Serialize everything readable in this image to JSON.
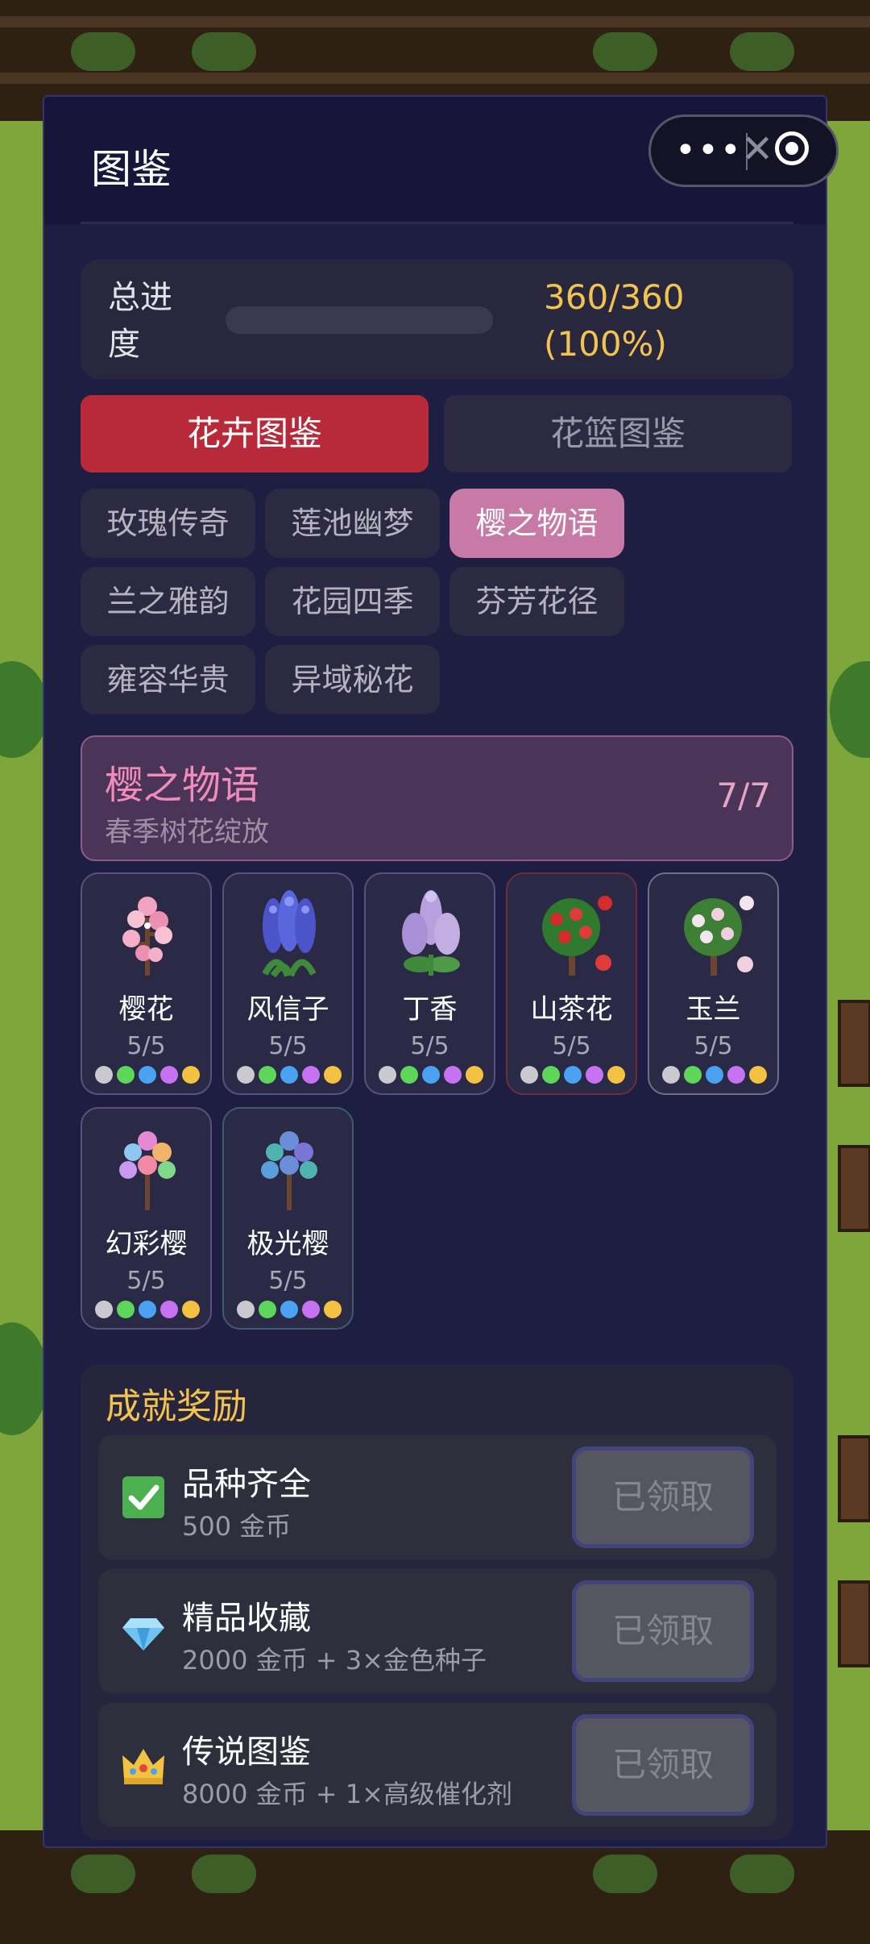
{
  "header": {
    "title": "图鉴",
    "capsule": {
      "more_icon": "more-dots-icon",
      "close_icon": "target-circle-icon",
      "more_label": "•••",
      "x_label": "✕"
    }
  },
  "progress": {
    "label": "总进度",
    "value_text": "360/360\n(100%)",
    "fraction": 1.0
  },
  "main_tabs": [
    {
      "label": "花卉图鉴",
      "active": true
    },
    {
      "label": "花篮图鉴",
      "active": false
    }
  ],
  "series_tabs": [
    {
      "label": "玫瑰传奇",
      "active": false
    },
    {
      "label": "莲池幽梦",
      "active": false
    },
    {
      "label": "樱之物语",
      "active": true
    },
    {
      "label": "兰之雅韵",
      "active": false
    },
    {
      "label": "花园四季",
      "active": false
    },
    {
      "label": "芬芳花径",
      "active": false
    },
    {
      "label": "雍容华贵",
      "active": false
    },
    {
      "label": "异域秘花",
      "active": false
    }
  ],
  "selected_series": {
    "name": "樱之物语",
    "description": "春季树花绽放",
    "count": "7/7"
  },
  "flowers": [
    {
      "name": "樱花",
      "count": "5/5",
      "art": "cherry-blossom-icon"
    },
    {
      "name": "风信子",
      "count": "5/5",
      "art": "hyacinth-icon"
    },
    {
      "name": "丁香",
      "count": "5/5",
      "art": "lilac-icon"
    },
    {
      "name": "山茶花",
      "count": "5/5",
      "art": "camellia-icon"
    },
    {
      "name": "玉兰",
      "count": "5/5",
      "art": "magnolia-icon"
    },
    {
      "name": "幻彩樱",
      "count": "5/5",
      "art": "rainbow-cherry-icon"
    },
    {
      "name": "极光樱",
      "count": "5/5",
      "art": "aurora-cherry-icon"
    }
  ],
  "quality_colors": [
    "#c9c9cf",
    "#5ed65a",
    "#4aa2f2",
    "#c772f2",
    "#f3c240"
  ],
  "achievements": {
    "title": "成就奖励",
    "items": [
      {
        "name": "品种齐全",
        "reward": "500 金币",
        "button": "已领取",
        "icon": "check-box-icon"
      },
      {
        "name": "精品收藏",
        "reward": "2000 金币 + 3×金色种子",
        "button": "已领取",
        "icon": "diamond-icon"
      },
      {
        "name": "传说图鉴",
        "reward": "8000 金币 + 1×高级催化剂",
        "button": "已领取",
        "icon": "crown-icon"
      }
    ]
  },
  "colors": {
    "panel": "#1e1d42",
    "accent_red": "#b82a3a",
    "accent_pink": "#c87aa6",
    "gold": "#f3c34f"
  }
}
